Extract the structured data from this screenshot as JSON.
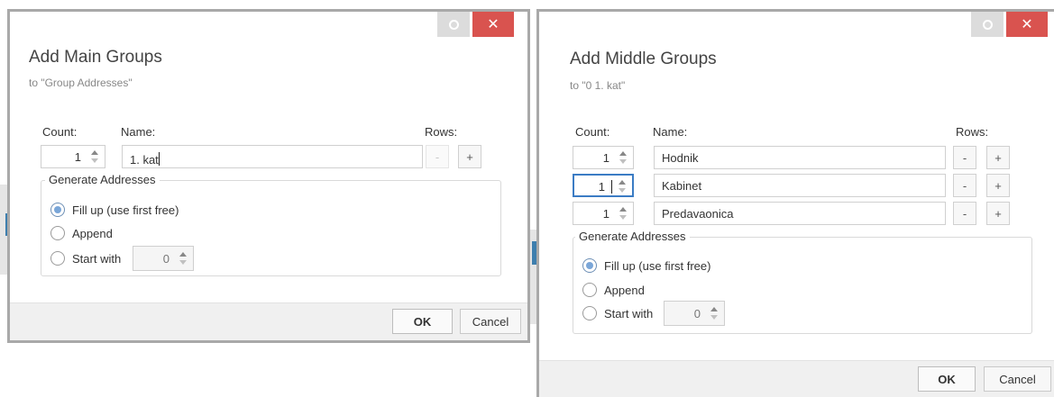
{
  "left_dialog": {
    "title": "Add Main Groups",
    "subtitle": "to \"Group Addresses\"",
    "count_label": "Count:",
    "name_label": "Name:",
    "rows_label": "Rows:",
    "rows": [
      {
        "count": "1",
        "name": "1. kat",
        "minus": "-",
        "plus": "+"
      }
    ],
    "generate": {
      "legend": "Generate Addresses",
      "options": [
        "Fill up (use first free)",
        "Append",
        "Start with"
      ],
      "selected": "Fill up (use first free)",
      "start_value": "0"
    },
    "ok_label": "OK",
    "cancel_label": "Cancel",
    "close_glyph": "✕"
  },
  "right_dialog": {
    "title": "Add Middle Groups",
    "subtitle": "to \"0 1. kat\"",
    "count_label": "Count:",
    "name_label": "Name:",
    "rows_label": "Rows:",
    "rows": [
      {
        "count": "1",
        "name": "Hodnik",
        "minus": "-",
        "plus": "+"
      },
      {
        "count": "1",
        "name": "Kabinet",
        "minus": "-",
        "plus": "+"
      },
      {
        "count": "1",
        "name": "Predavaonica",
        "minus": "-",
        "plus": "+"
      }
    ],
    "generate": {
      "legend": "Generate Addresses",
      "options": [
        "Fill up (use first free)",
        "Append",
        "Start with"
      ],
      "selected": "Fill up (use first free)",
      "start_value": "0"
    },
    "ok_label": "OK",
    "cancel_label": "Cancel",
    "close_glyph": "✕"
  },
  "colors": {
    "accent": "#3e7fae",
    "close": "#d9534f",
    "focus": "#3b7cc4"
  }
}
